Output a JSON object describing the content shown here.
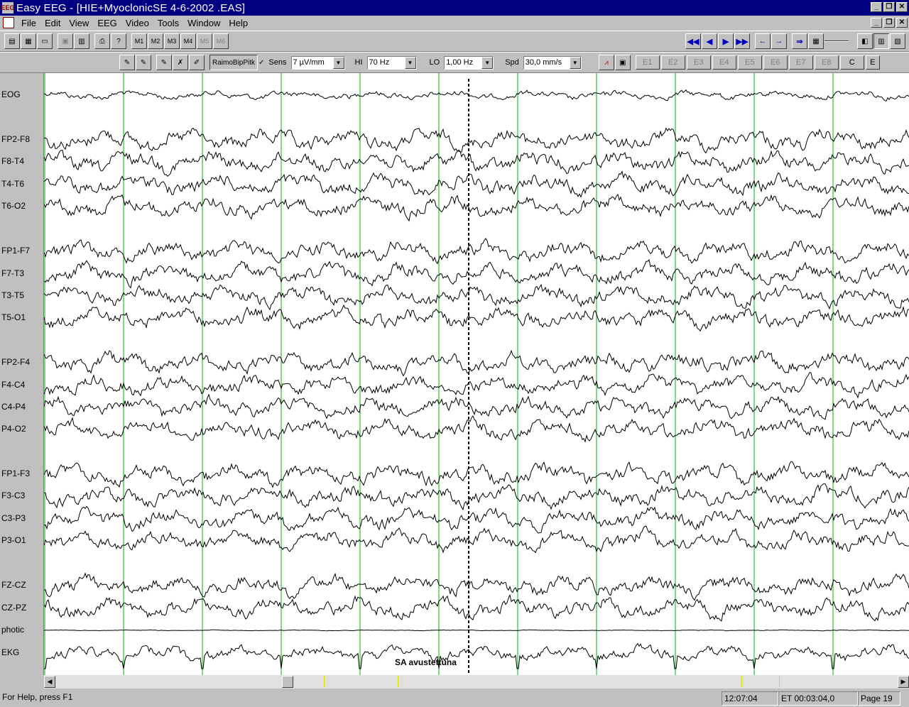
{
  "window": {
    "title": "Easy EEG - [HIE+MyoclonicSE  4-6-2002 .EAS]",
    "icon": "eeg-app-icon"
  },
  "menu": [
    "File",
    "Edit",
    "View",
    "EEG",
    "Video",
    "Tools",
    "Window",
    "Help"
  ],
  "toolbar1": {
    "montage_buttons": [
      "M1",
      "M2",
      "M3",
      "M4",
      "M5",
      "M6"
    ],
    "nav_icons": [
      "rewind-icon",
      "step-back-icon",
      "step-forward-icon",
      "fast-forward-icon",
      "page-left-icon",
      "page-right-icon",
      "jump-icon"
    ]
  },
  "toolbar2": {
    "montage_name": "RaimoBipPitk",
    "sens_label": "Sens",
    "sens_value": "7 µV/mm",
    "hi_label": "HI",
    "hi_value": "70 Hz",
    "lo_label": "LO",
    "lo_value": "1,00 Hz",
    "spd_label": "Spd",
    "spd_value": "30,0 mm/s",
    "event_buttons": [
      "E1",
      "E2",
      "E3",
      "E4",
      "E5",
      "E6",
      "E7",
      "E8"
    ],
    "c_button": "C",
    "e_button": "E"
  },
  "channels": [
    "EOG",
    "FP2-F8",
    "F8-T4",
    "T4-T6",
    "T6-O2",
    "FP1-F7",
    "F7-T3",
    "T3-T5",
    "T5-O1",
    "FP2-F4",
    "F4-C4",
    "C4-P4",
    "P4-O2",
    "FP1-F3",
    "F3-C3",
    "C3-P3",
    "P3-O1",
    "FZ-CZ",
    "CZ-PZ",
    "photic",
    "EKG"
  ],
  "annotation": "SA avustettuna",
  "colors": {
    "grid": "#00b400",
    "trace": "#000000",
    "title_bar": "#000080",
    "nav_blue": "#0000c0"
  },
  "status": {
    "help": "For Help, press F1",
    "clock": "12:07:04",
    "elapsed": "ET 00:03:04,0",
    "page": "Page 19"
  }
}
